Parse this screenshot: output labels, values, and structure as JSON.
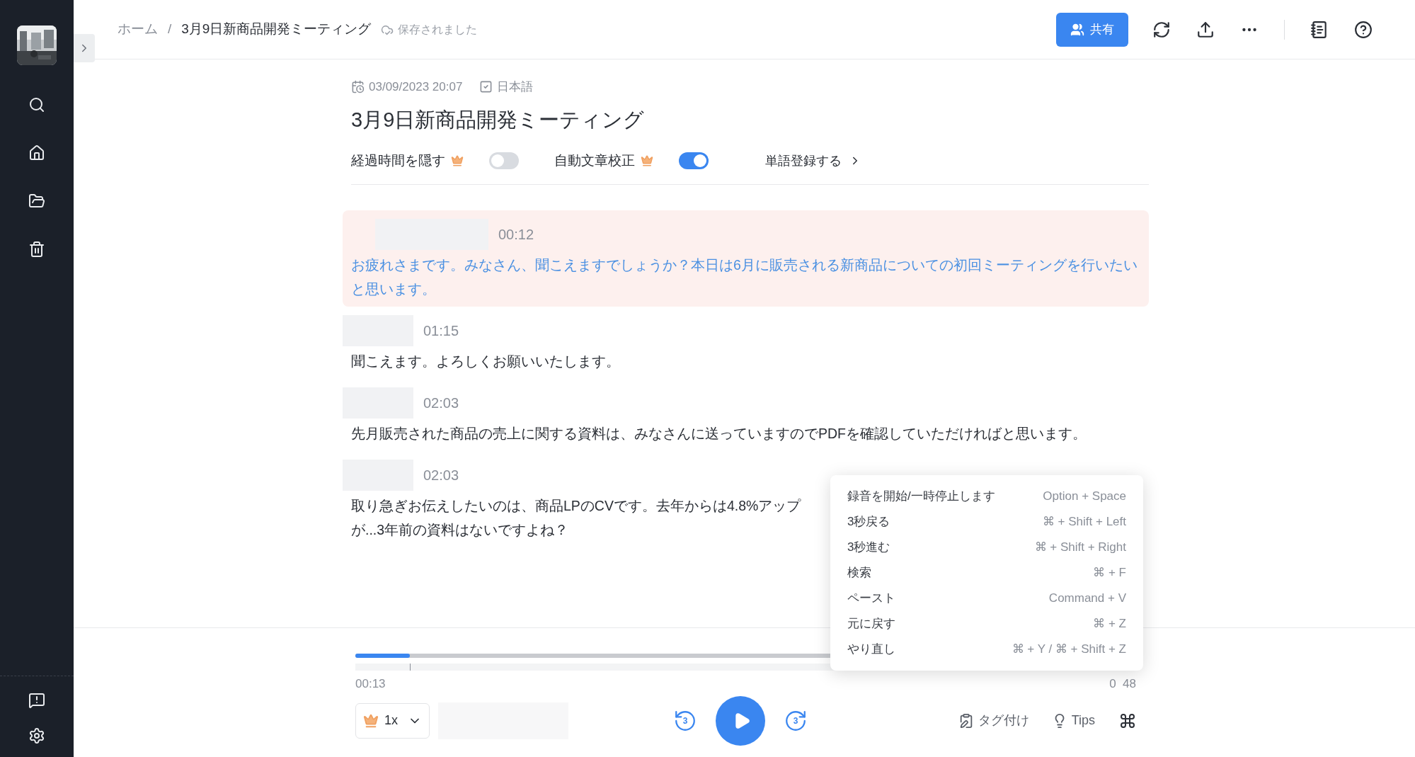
{
  "breadcrumb": {
    "home": "ホーム",
    "separator": "/",
    "current": "3月9日新商品開発ミーティング",
    "save_status": "保存されました"
  },
  "header_actions": {
    "share": "共有"
  },
  "meta": {
    "datetime": "03/09/2023 20:07",
    "language": "日本語"
  },
  "title": "3月9日新商品開発ミーティング",
  "options": [
    {
      "label": "経過時間を隠す",
      "premium": true,
      "on": false
    },
    {
      "label": "自動文章校正",
      "premium": true,
      "on": true
    }
  ],
  "dictionary_link": "単語登録する",
  "segments": [
    {
      "time": "00:12",
      "selected": true,
      "text": "お疲れさまです。みなさん、聞こえますでしょうか？本日は6月に販売される新商品についての初回ミーティングを行いたいと思います。"
    },
    {
      "time": "01:15",
      "selected": false,
      "text": "聞こえます。よろしくお願いいたします。"
    },
    {
      "time": "02:03",
      "selected": false,
      "text": "先月販売された商品の売上に関する資料は、みなさんに送っていますのでPDFを確認していただければと思います。"
    },
    {
      "time": "02:03",
      "selected": false,
      "lines": [
        "取り急ぎお伝えしたいのは、商品LPのCVです。去年からは4.8%アップ",
        "が...3年前の資料はないですよね？"
      ]
    }
  ],
  "player": {
    "level": 0.07,
    "current_time": "00:13",
    "end_time": "0  48",
    "speed": "1x",
    "rewind": "3",
    "forward": "3",
    "tag": "タグ付け",
    "tips": "Tips"
  },
  "shortcuts": [
    {
      "action": "録音を開始/一時停止します",
      "keys": "Option + Space"
    },
    {
      "action": "3秒戻る",
      "keys": "⌘ + Shift + Left"
    },
    {
      "action": "3秒進む",
      "keys": "⌘ + Shift + Right"
    },
    {
      "action": "検索",
      "keys": "⌘ + F"
    },
    {
      "action": "ペースト",
      "keys": "Command + V"
    },
    {
      "action": "元に戻す",
      "keys": "⌘ + Z"
    },
    {
      "action": "やり直し",
      "keys": "⌘ + Y / ⌘ + Shift + Z"
    }
  ]
}
